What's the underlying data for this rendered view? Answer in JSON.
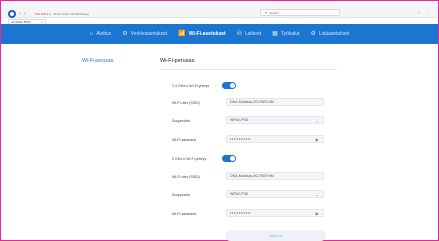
{
  "browser": {
    "address_host": "192.168.1.1",
    "address_rest": "/html/content.html#wifieasy",
    "tab_label": "HUAWEI B535",
    "tab_close": "×",
    "search_placeholder": "Search",
    "nav_arrows": "‹ ›",
    "right_icons": "☆ ⋮"
  },
  "topnav": {
    "items": [
      {
        "icon": "⌂",
        "label": "Aloitus",
        "active": false
      },
      {
        "icon": "⚙",
        "label": "Verkkoasetukset",
        "active": false
      },
      {
        "icon": "📶",
        "label": "Wi-Fi-asetukset",
        "active": true
      },
      {
        "icon": "⛁",
        "label": "Laitteet",
        "active": false
      },
      {
        "icon": "▦",
        "label": "Työkalut",
        "active": false
      },
      {
        "icon": "⚙",
        "label": "Lisäasetukset",
        "active": false
      }
    ]
  },
  "sidebar": {
    "link": "Wi-Fi-perusas."
  },
  "main": {
    "title": "Wi-Fi-perusas.",
    "band24": {
      "toggle_label": "2,4 GHz:n Wi-Fi-yhteys",
      "toggle_on": true,
      "ssid_label": "Wi-Fi-nimi (SSID)",
      "ssid_value": "DNA-Mokkula-2G-R8SY4M",
      "security_label": "Suojaustila",
      "security_value": "WPA2-PSK",
      "password_label": "Wi-Fi-salasana",
      "password_value": "••••••••••••"
    },
    "band5": {
      "toggle_label": "5 GHz:n Wi-Fi-yhteys",
      "toggle_on": true,
      "ssid_label": "Wi-Fi-nimi (SSID)",
      "ssid_value": "DNA-Mokkula-5G-R8SY4M",
      "security_label": "Suojaustila",
      "security_value": "WPA2-PSK",
      "password_label": "Wi-Fi-salasana",
      "password_value": "••••••••••••"
    },
    "save_label": "Tallenna"
  },
  "colors": {
    "accent": "#1b76d1",
    "frame": "#e8279a"
  }
}
